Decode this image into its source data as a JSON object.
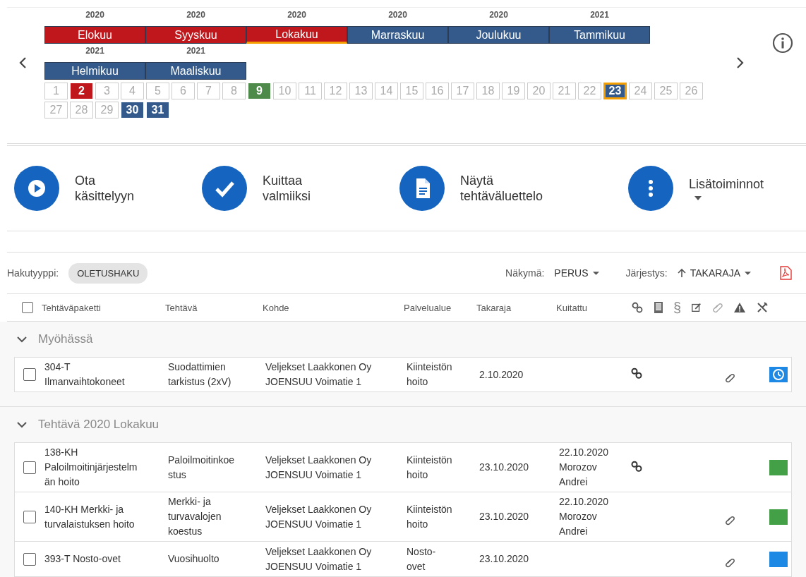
{
  "calendar": {
    "months": [
      {
        "year": "2020",
        "name": "Elokuu",
        "color": "#c0171c",
        "selected": false
      },
      {
        "year": "2020",
        "name": "Syyskuu",
        "color": "#c0171c",
        "selected": false
      },
      {
        "year": "2020",
        "name": "Lokakuu",
        "color": "#c0171c",
        "selected": true
      },
      {
        "year": "2020",
        "name": "Marraskuu",
        "color": "#335a8a",
        "selected": false
      },
      {
        "year": "2020",
        "name": "Joulukuu",
        "color": "#335a8a",
        "selected": false
      },
      {
        "year": "2021",
        "name": "Tammikuu",
        "color": "#335a8a",
        "selected": false
      },
      {
        "year": "2021",
        "name": "Helmikuu",
        "color": "#335a8a",
        "selected": false
      },
      {
        "year": "2021",
        "name": "Maaliskuu",
        "color": "#335a8a",
        "selected": false
      }
    ],
    "days": [
      {
        "label": "1",
        "selected": false
      },
      {
        "label": "2",
        "color": "#c0171c",
        "selected": false
      },
      {
        "label": "3",
        "selected": false
      },
      {
        "label": "4",
        "selected": false
      },
      {
        "label": "5",
        "selected": false
      },
      {
        "label": "6",
        "selected": false
      },
      {
        "label": "7",
        "selected": false
      },
      {
        "label": "8",
        "selected": false
      },
      {
        "label": "9",
        "color": "#4e8a4a",
        "selected": false
      },
      {
        "label": "10",
        "selected": false
      },
      {
        "label": "11",
        "selected": false
      },
      {
        "label": "12",
        "selected": false
      },
      {
        "label": "13",
        "selected": false
      },
      {
        "label": "14",
        "selected": false
      },
      {
        "label": "15",
        "selected": false
      },
      {
        "label": "16",
        "selected": false
      },
      {
        "label": "17",
        "selected": false
      },
      {
        "label": "18",
        "selected": false
      },
      {
        "label": "19",
        "selected": false
      },
      {
        "label": "20",
        "selected": false
      },
      {
        "label": "21",
        "selected": false
      },
      {
        "label": "22",
        "selected": false
      },
      {
        "label": "23",
        "color": "#335a8a",
        "selected": true
      },
      {
        "label": "24",
        "selected": false
      },
      {
        "label": "25",
        "selected": false
      },
      {
        "label": "26",
        "selected": false
      },
      {
        "label": "27",
        "selected": false
      },
      {
        "label": "28",
        "selected": false
      },
      {
        "label": "29",
        "selected": false
      },
      {
        "label": "30",
        "color": "#335a8a",
        "selected": false
      },
      {
        "label": "31",
        "color": "#335a8a",
        "selected": false
      }
    ]
  },
  "actions": [
    {
      "kind": "play",
      "label": "Ota käsittelyyn"
    },
    {
      "kind": "check",
      "label": "Kuittaa valmiiksi"
    },
    {
      "kind": "document",
      "label": "Näytä tehtäväluettelo"
    },
    {
      "kind": "more",
      "label": "Lisätoiminnot",
      "dropdown": true
    }
  ],
  "filters": {
    "search_type_label": "Hakutyyppi:",
    "search_type": "OLETUSHAKU",
    "view_label": "Näkymä:",
    "view": "PERUS",
    "sort_label": "Järjestys:",
    "sort": "TAKARAJA"
  },
  "table": {
    "all_checked": false,
    "columns": [
      "Tehtäväpaketti",
      "Tehtävä",
      "Kohde",
      "Palvelualue",
      "Takaraja",
      "Kuitattu"
    ],
    "section_symbol": "§",
    "groups": [
      {
        "title": "Myöhässä",
        "expanded": true,
        "rows": [
          {
            "checked": false,
            "package": "304-T\nIlmanvaihtokoneet",
            "task": "Suodattimien\ntarkistus (2xV)",
            "target": "Veljekset Laakkonen Oy\nJOENSUU Voimatie 1",
            "area": "Kiinteistön\nhoito",
            "deadline": "2.10.2020",
            "acknowledged": "",
            "linked": true,
            "attachment": true,
            "status": {
              "kind": "clock",
              "color": "#1e88e5"
            }
          }
        ]
      },
      {
        "title": "Tehtävä 2020 Lokakuu",
        "expanded": true,
        "rows": [
          {
            "checked": false,
            "package": "138-KH\nPaloilmoitinjärjestelm\nän hoito",
            "task": "Paloilmoitinkoe\nstus",
            "target": "Veljekset Laakkonen Oy\nJOENSUU Voimatie 1",
            "area": "Kiinteistön\nhoito",
            "deadline": "23.10.2020",
            "acknowledged": "22.10.2020\nMorozov\nAndrei",
            "linked": true,
            "attachment": false,
            "status": {
              "kind": "square",
              "color": "#43a047"
            }
          },
          {
            "checked": false,
            "package": "140-KH Merkki- ja\nturvalaistuksen hoito",
            "task": "Merkki- ja\nturvavalojen\nkoestus",
            "target": "Veljekset Laakkonen Oy\nJOENSUU Voimatie 1",
            "area": "Kiinteistön\nhoito",
            "deadline": "23.10.2020",
            "acknowledged": "22.10.2020\nMorozov\nAndrei",
            "linked": false,
            "attachment": true,
            "status": {
              "kind": "square",
              "color": "#43a047"
            }
          },
          {
            "checked": false,
            "package": "393-T Nosto-ovet",
            "task": "Vuosihuolto",
            "target": "Veljekset Laakkonen Oy\nJOENSUU Voimatie 1",
            "area": "Nosto-\novet",
            "deadline": "23.10.2020",
            "acknowledged": "",
            "linked": false,
            "attachment": true,
            "status": {
              "kind": "square",
              "color": "#1e88e5"
            }
          }
        ]
      }
    ]
  }
}
